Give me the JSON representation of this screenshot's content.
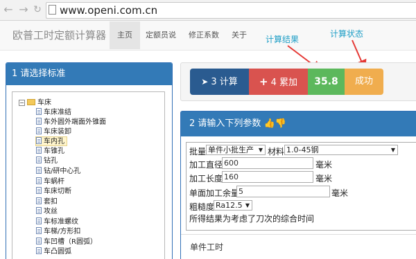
{
  "browser": {
    "url": "www.openi.com.cn",
    "back_icon": "arrow-left-icon",
    "forward_icon": "arrow-right-icon"
  },
  "navbar": {
    "brand": "欧普工时定额计算器",
    "items": [
      {
        "label": "主页",
        "active": true
      },
      {
        "label": "定额员说",
        "active": false
      },
      {
        "label": "修正系数",
        "active": false
      },
      {
        "label": "关于",
        "active": false
      }
    ]
  },
  "annotations": {
    "result_label": "计算结果",
    "status_label": "计算状态",
    "color": "#1e9ec6",
    "arrow_color": "#e53935"
  },
  "standards_panel": {
    "title": "1 请选择标准",
    "root": "车床",
    "items": [
      "车床准结",
      "车外圆外端面外锥面",
      "车床装卸",
      "车内孔",
      "车锥孔",
      "钻孔",
      "钻/研中心孔",
      "车蜗杆",
      "车床切断",
      "套扣",
      "攻丝",
      "车标准螺纹",
      "车梯/方形扣",
      "车凹槽（R圆弧）",
      "车凸圆弧"
    ],
    "selected": "车内孔"
  },
  "result_bar": {
    "calc_label": "3 计算",
    "accumulate_label": "4 累加",
    "result_value": "35.8",
    "status_text": "成功",
    "colors": {
      "calc": "#2a5b90",
      "accumulate": "#d9534f",
      "result": "#5cb85c",
      "status": "#f0ad4e"
    }
  },
  "params_panel": {
    "title": "2 请输入下列参数",
    "batch_label": "批量",
    "batch_value": "单件小批生产",
    "material_label": "材料",
    "material_value": "1.0-45钢",
    "diameter_label": "加工直径",
    "diameter_value": "600",
    "diameter_unit": "毫米",
    "length_label": "加工长度",
    "length_value": "160",
    "length_unit": "毫米",
    "allowance_label": "单面加工余量",
    "allowance_value": "5",
    "allowance_unit": "毫米",
    "roughness_label": "粗糙度",
    "roughness_value": "Ra12.5",
    "note": "所得结果为考虑了刀次的综合时间",
    "footer_label": "单件工时"
  }
}
